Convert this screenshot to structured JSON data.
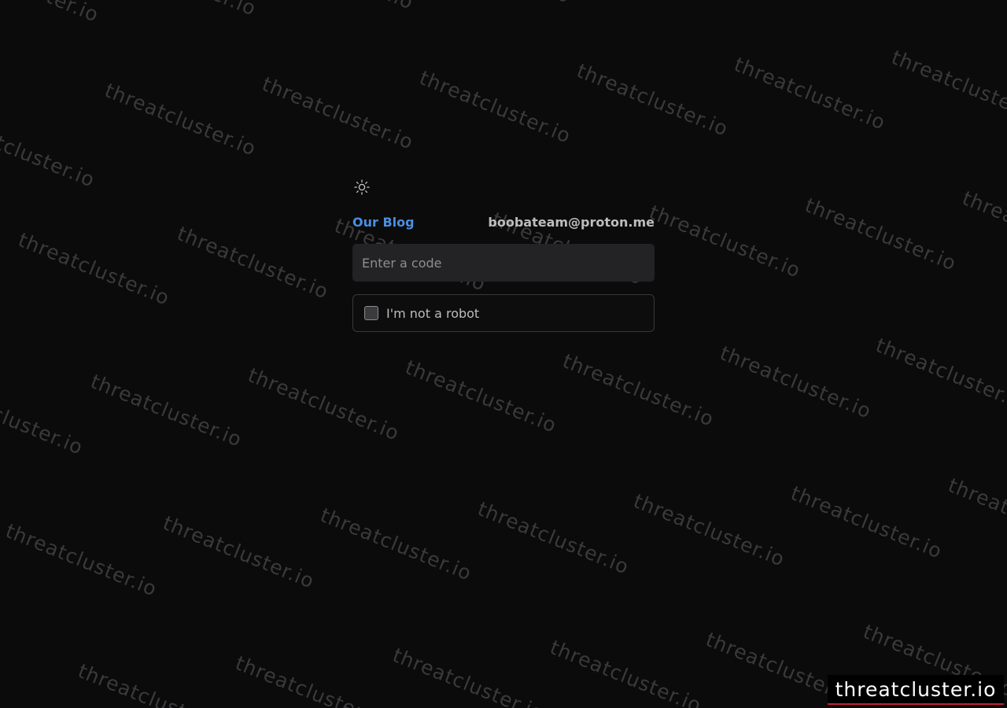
{
  "watermark": {
    "text": "threatcluster.io",
    "color": "#3a3a3c"
  },
  "theme_toggle": {
    "icon": "sun-icon"
  },
  "header": {
    "blog_link": "Our Blog",
    "contact_email": "boobateam@proton.me"
  },
  "code_input": {
    "placeholder": "Enter a code",
    "value": ""
  },
  "captcha": {
    "label": "I'm not a robot",
    "checked": false
  },
  "brand_badge": {
    "text": "threatcluster.io",
    "accent_color": "#c2203a"
  },
  "colors": {
    "background": "#0b0b0c",
    "link": "#4a8fe0",
    "text": "#bdbdbf",
    "input_bg": "#232325"
  }
}
